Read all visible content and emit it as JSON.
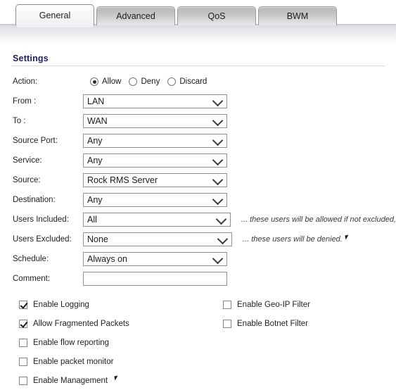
{
  "tabs": [
    {
      "label": "General",
      "active": true
    },
    {
      "label": "Advanced",
      "active": false
    },
    {
      "label": "QoS",
      "active": false
    },
    {
      "label": "BWM",
      "active": false
    }
  ],
  "section": {
    "title": "Settings"
  },
  "action": {
    "label": "Action:",
    "options": [
      {
        "label": "Allow",
        "selected": true
      },
      {
        "label": "Deny",
        "selected": false
      },
      {
        "label": "Discard",
        "selected": false
      }
    ]
  },
  "fields": [
    {
      "label": "From :",
      "value": "LAN",
      "type": "select"
    },
    {
      "label": "To :",
      "value": "WAN",
      "type": "select"
    },
    {
      "label": "Source Port:",
      "value": "Any",
      "type": "select"
    },
    {
      "label": "Service:",
      "value": "Any",
      "type": "select"
    },
    {
      "label": "Source:",
      "value": "Rock RMS Server",
      "type": "select"
    },
    {
      "label": "Destination:",
      "value": "Any",
      "type": "select"
    },
    {
      "label": "Users Included:",
      "value": "All",
      "type": "select",
      "note": "... these users will be allowed if not excluded,"
    },
    {
      "label": "Users Excluded:",
      "value": "None",
      "type": "select",
      "note": "... these users will be denied."
    },
    {
      "label": "Schedule:",
      "value": "Always on",
      "type": "select"
    },
    {
      "label": "Comment:",
      "value": "",
      "type": "text",
      "placeholder": ""
    }
  ],
  "checkboxes": {
    "left": [
      {
        "label": "Enable Logging",
        "checked": true
      },
      {
        "label": "Allow Fragmented Packets",
        "checked": true
      },
      {
        "label": "Enable flow reporting",
        "checked": false
      },
      {
        "label": "Enable packet monitor",
        "checked": false
      },
      {
        "label": "Enable Management",
        "checked": false
      }
    ],
    "right": [
      {
        "label": "Enable Geo-IP Filter",
        "checked": false
      },
      {
        "label": "Enable Botnet Filter",
        "checked": false
      }
    ]
  },
  "colors": {
    "section_title": "#1f1f5c",
    "tab_active_bg": "#f6f6f6",
    "tab_inactive_bg": "#c4c4c4",
    "field_border": "#8f8f8f",
    "band": "#dcdce2"
  }
}
